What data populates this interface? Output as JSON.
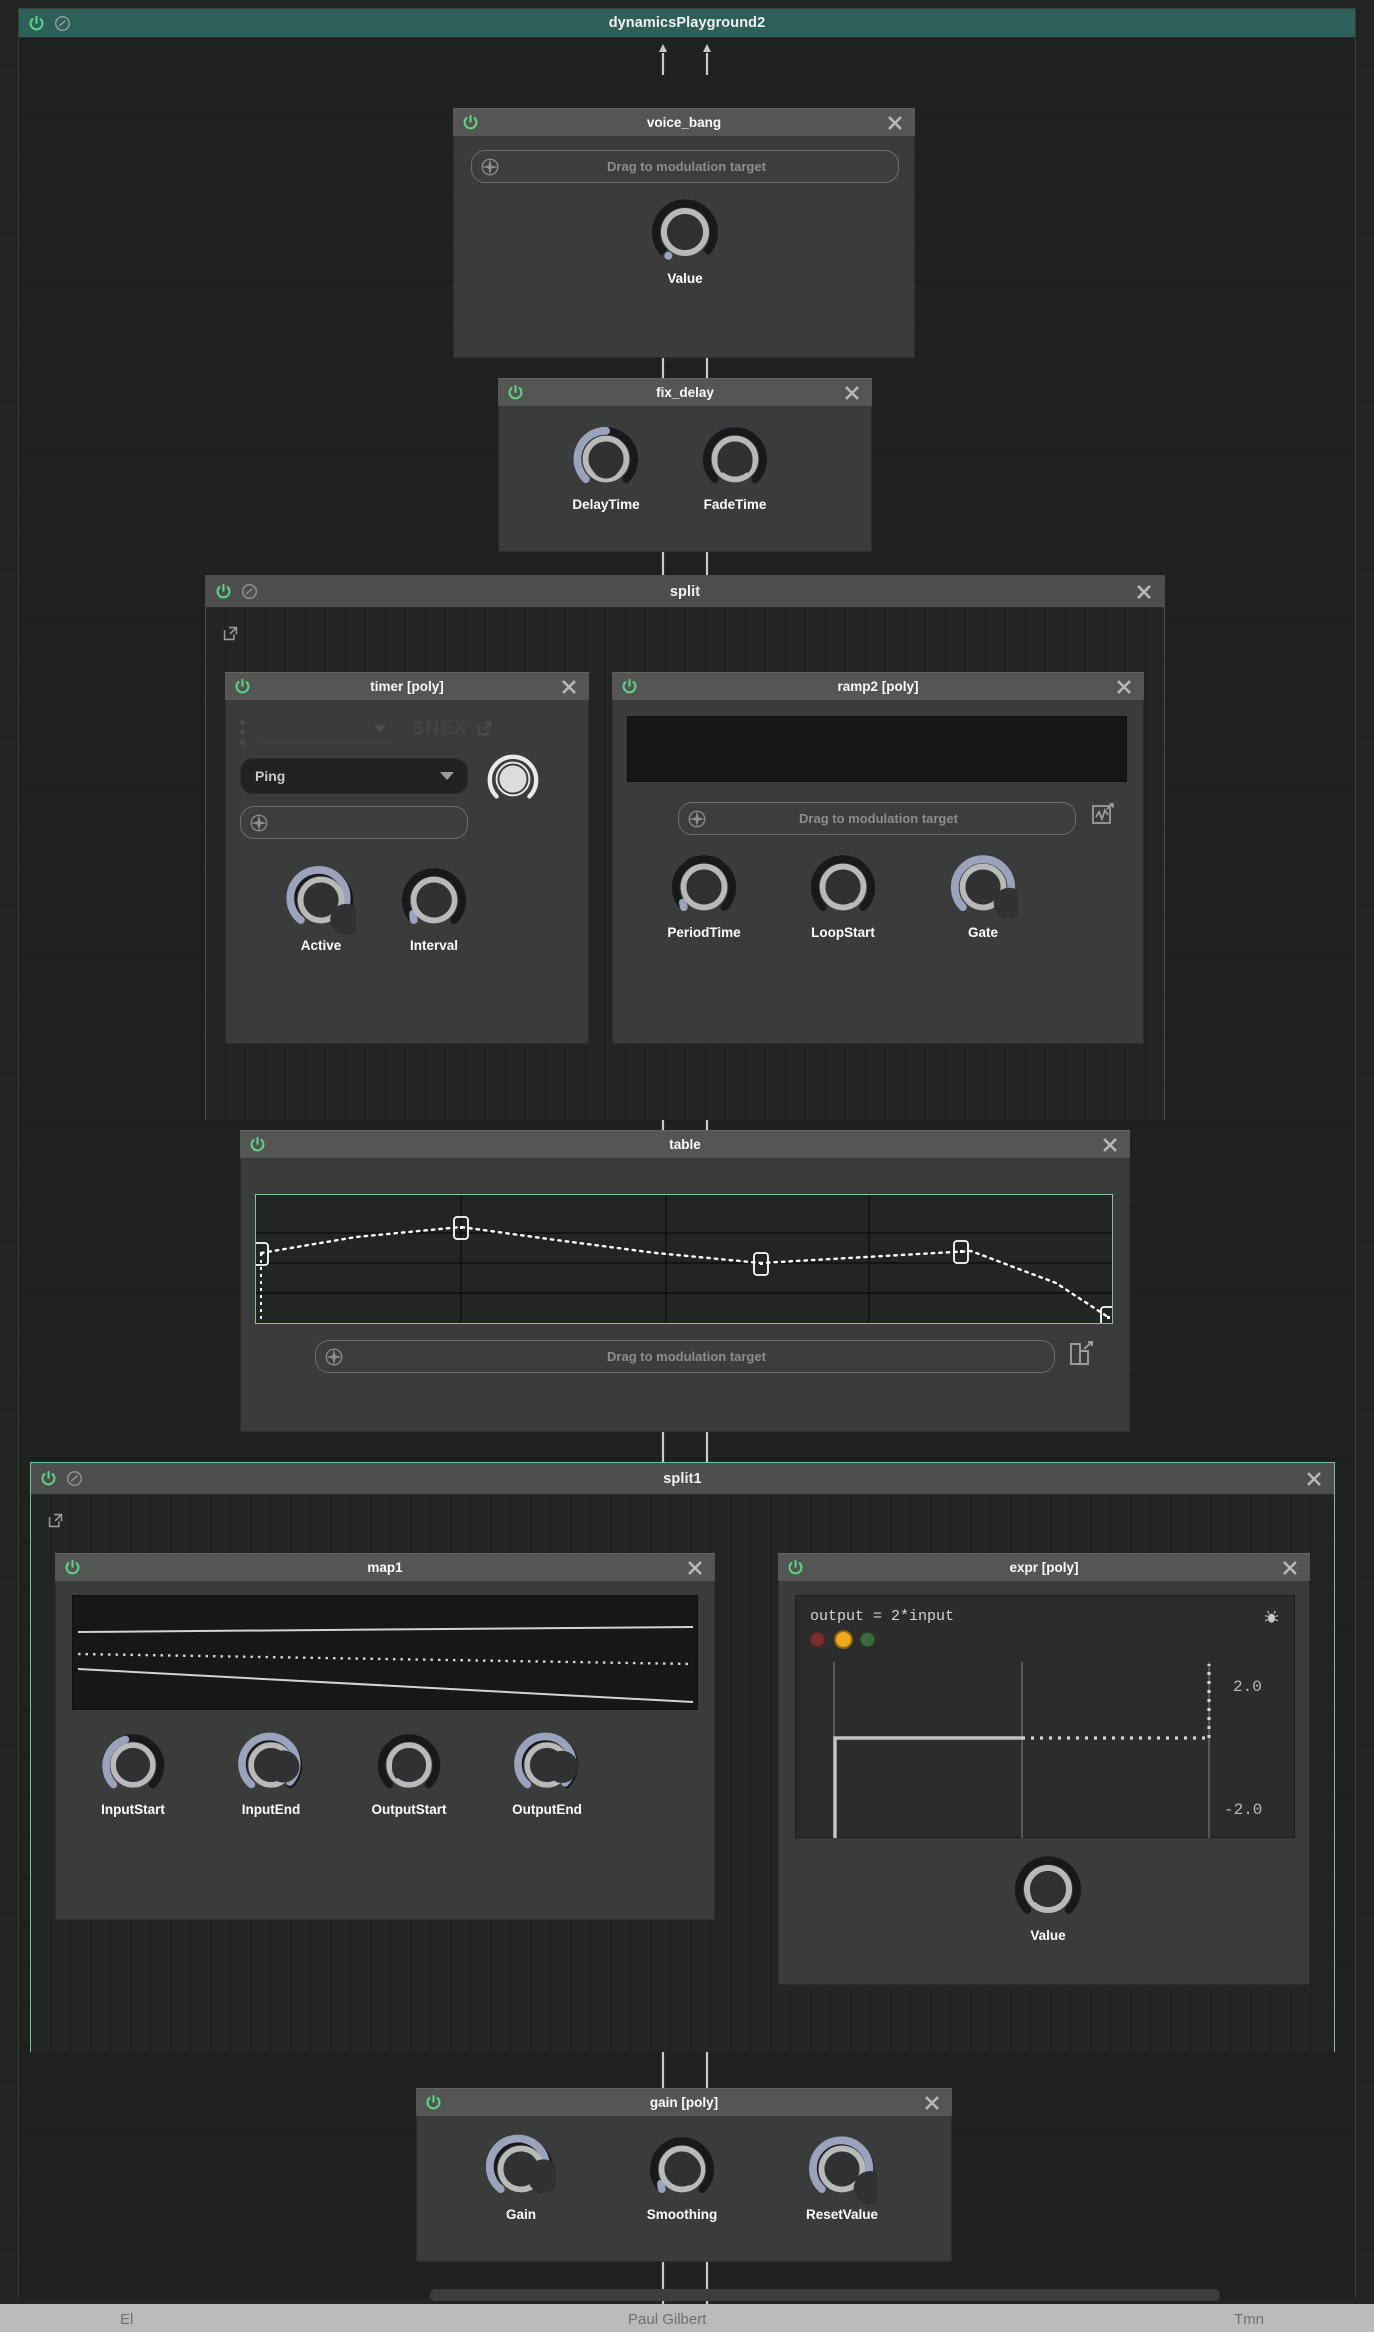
{
  "window": {
    "title": "dynamicsPlayground2",
    "accent_teal": "#2e5f58",
    "power_green": "#5fd38a",
    "knob_fill": "#9aa3bb",
    "container_border_green": "#7fbf96"
  },
  "icons": {
    "power": "power-icon",
    "bypass": "bypass-icon",
    "close": "close-icon",
    "external": "external-link-icon",
    "mod_target": "modulation-target-icon",
    "waveform": "waveform-popup-icon",
    "table_popup": "table-popup-icon",
    "bug": "bug-icon",
    "dropdown_arrow": "chevron-down-icon"
  },
  "labels": {
    "drag_mod": "Drag to modulation target",
    "snex": "SNEX"
  },
  "nodes": {
    "voice_bang": {
      "title": "voice_bang",
      "mod_target": "Drag to modulation target",
      "knobs": [
        {
          "label": "Value",
          "value": 0.0
        }
      ]
    },
    "fix_delay": {
      "title": "fix_delay",
      "knobs": [
        {
          "label": "DelayTime",
          "value": 0.3
        },
        {
          "label": "FadeTime",
          "value": 0.0
        }
      ]
    },
    "split": {
      "title": "split"
    },
    "timer": {
      "title": "timer [poly]",
      "ghost_dropdown": "",
      "snex_label": "SNEX",
      "mode": "Ping",
      "knobs": [
        {
          "label": "Active",
          "value": 0.93
        },
        {
          "label": "Interval",
          "value": 0.1
        }
      ]
    },
    "ramp2": {
      "title": "ramp2 [poly]",
      "mod_target": "Drag to modulation target",
      "knobs": [
        {
          "label": "PeriodTime",
          "value": 0.06
        },
        {
          "label": "LoopStart",
          "value": 0.0
        },
        {
          "label": "Gate",
          "value": 1.0
        }
      ]
    },
    "table": {
      "title": "table",
      "mod_target": "Drag to modulation target"
    },
    "split1": {
      "title": "split1"
    },
    "map1": {
      "title": "map1",
      "knobs": [
        {
          "label": "InputStart",
          "value": 0.62
        },
        {
          "label": "InputEnd",
          "value": 0.9
        },
        {
          "label": "OutputStart",
          "value": 0.0
        },
        {
          "label": "OutputEnd",
          "value": 0.92
        }
      ]
    },
    "expr": {
      "title": "expr [poly]",
      "code": "output = 2*input",
      "status_dots": [
        "#7a2d2d",
        "#f0a81c",
        "#3d6b3d"
      ],
      "y_max": "2.0",
      "y_min": "-2.0",
      "knobs": [
        {
          "label": "Value",
          "value": 0.0
        }
      ]
    },
    "gain": {
      "title": "gain [poly]",
      "knobs": [
        {
          "label": "Gain",
          "value": 0.8
        },
        {
          "label": "Smoothing",
          "value": 0.1
        },
        {
          "label": "ResetValue",
          "value": 0.97
        }
      ]
    }
  },
  "chart_data": [
    {
      "id": "table-curve",
      "type": "line",
      "title": "table",
      "xlabel": "",
      "ylabel": "",
      "xlim": [
        0,
        1
      ],
      "ylim": [
        0,
        1
      ],
      "grid": true,
      "x": [
        0.0,
        0.25,
        0.6,
        0.8,
        1.0
      ],
      "y": [
        0.55,
        0.82,
        0.5,
        0.56,
        0.02
      ],
      "point_count": 5,
      "line_style": "dotted",
      "line_color": "#ffffff"
    },
    {
      "id": "map1-lines",
      "type": "line",
      "title": "map1",
      "xlabel": "",
      "ylabel": "",
      "xlim": [
        0,
        1
      ],
      "ylim": [
        0,
        1
      ],
      "grid": false,
      "series": [
        {
          "name": "upper",
          "style": "solid",
          "x": [
            0,
            1
          ],
          "y": [
            0.68,
            0.72
          ]
        },
        {
          "name": "middle",
          "style": "dotted",
          "x": [
            0,
            1
          ],
          "y": [
            0.5,
            0.4
          ]
        },
        {
          "name": "lower",
          "style": "solid",
          "x": [
            0,
            1
          ],
          "y": [
            0.32,
            0.02
          ]
        }
      ]
    },
    {
      "id": "expr-plot",
      "type": "line",
      "title": "expr [poly]",
      "xlabel": "",
      "ylabel": "",
      "ylim": [
        -2.0,
        2.0
      ],
      "y_tick_labels": [
        "2.0",
        "-2.0"
      ],
      "grid": false,
      "series": [
        {
          "name": "signal",
          "style": "solid",
          "x": [
            0.02,
            0.02,
            0.55
          ],
          "y": [
            -1.0,
            0.0,
            0.0
          ]
        },
        {
          "name": "hold",
          "style": "dotted",
          "x": [
            0.55,
            0.93,
            0.93
          ],
          "y": [
            0.0,
            0.0,
            2.0
          ]
        }
      ]
    }
  ],
  "footer": {
    "left": "El",
    "center": "Paul Gilbert",
    "right": "Tmn"
  }
}
